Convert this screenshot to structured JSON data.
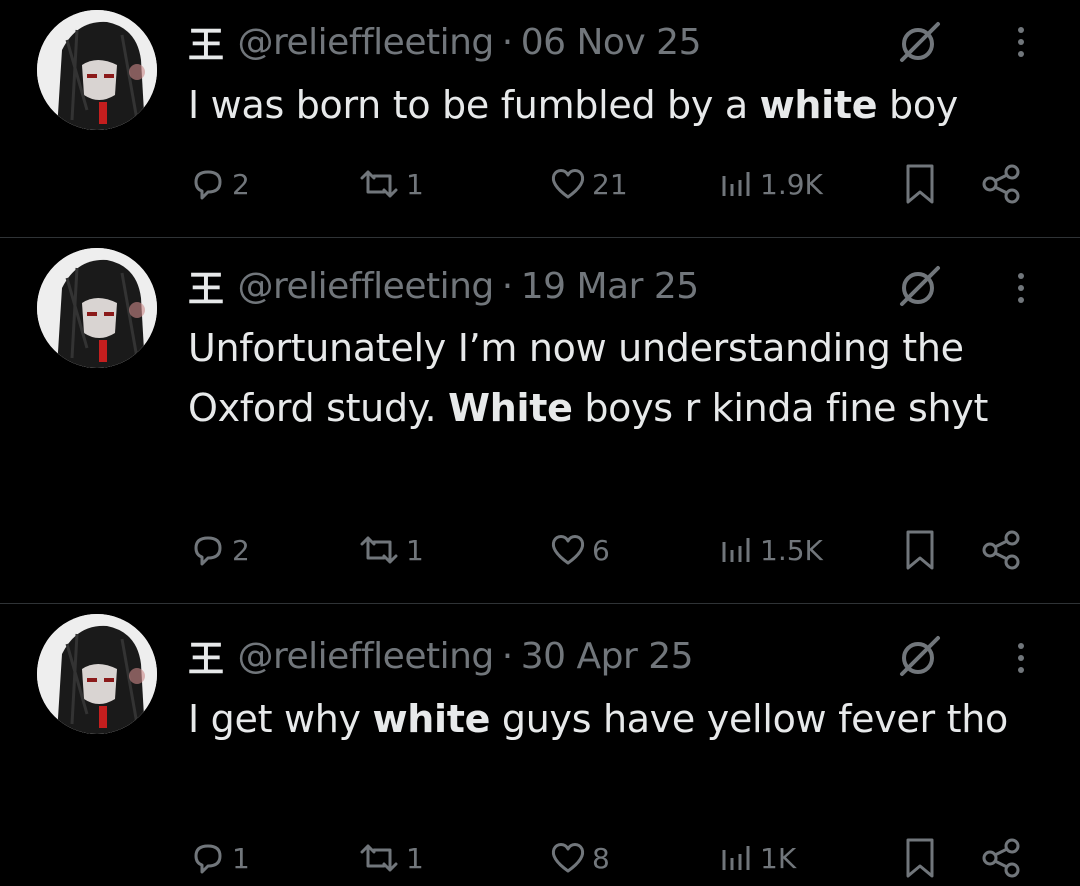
{
  "colors": {
    "background": "#000000",
    "text": "#e7e9ea",
    "muted": "#71767b",
    "divider": "#2f3336"
  },
  "icons": {
    "reply": "reply-icon",
    "repost": "repost-icon",
    "like": "heart-icon",
    "views": "views-icon",
    "bookmark": "bookmark-icon",
    "share": "share-icon",
    "grok": "grok-icon",
    "more": "more-icon"
  },
  "tweets": [
    {
      "name": "王",
      "handle": "@relieffleeting",
      "separator": "·",
      "date": "06 Nov 25",
      "text_parts": [
        "I was born to be fumbled by a ",
        "white",
        " boy"
      ],
      "replies": "2",
      "reposts": "1",
      "likes": "21",
      "views": "1.9K"
    },
    {
      "name": "王",
      "handle": "@relieffleeting",
      "separator": "·",
      "date": "19 Mar 25",
      "text_parts": [
        "Unfortunately I’m now understanding the Oxford study. ",
        "White",
        " boys r kinda fine shyt"
      ],
      "replies": "2",
      "reposts": "1",
      "likes": "6",
      "views": "1.5K"
    },
    {
      "name": "王",
      "handle": "@relieffleeting",
      "separator": "·",
      "date": "30 Apr 25",
      "text_parts": [
        "I get why ",
        "white",
        " guys have yellow fever tho"
      ],
      "replies": "1",
      "reposts": "1",
      "likes": "8",
      "views": "1K"
    }
  ]
}
